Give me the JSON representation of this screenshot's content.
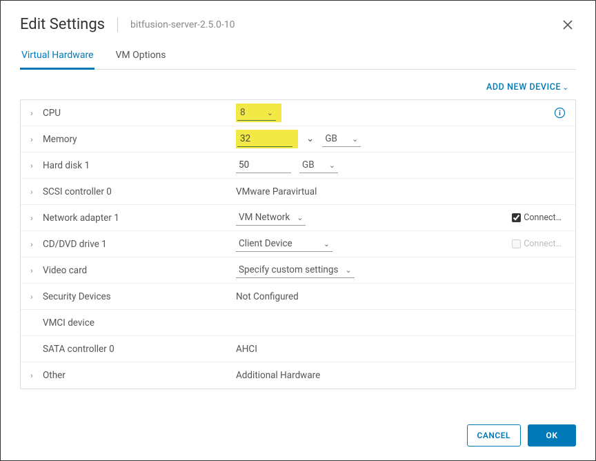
{
  "header": {
    "title": "Edit Settings",
    "subtitle": "bitfusion-server-2.5.0-10"
  },
  "tabs": {
    "hardware": "Virtual Hardware",
    "options": "VM Options"
  },
  "add_device": "ADD NEW DEVICE",
  "rows": {
    "cpu": {
      "label": "CPU",
      "value": "8"
    },
    "memory": {
      "label": "Memory",
      "value": "32",
      "unit": "GB"
    },
    "disk": {
      "label": "Hard disk 1",
      "value": "50",
      "unit": "GB"
    },
    "scsi": {
      "label": "SCSI controller 0",
      "value": "VMware Paravirtual"
    },
    "net": {
      "label": "Network adapter 1",
      "value": "VM Network",
      "connect": "Connect…"
    },
    "cdrom": {
      "label": "CD/DVD drive 1",
      "value": "Client Device",
      "connect": "Connect…"
    },
    "video": {
      "label": "Video card",
      "value": "Specify custom settings"
    },
    "sec": {
      "label": "Security Devices",
      "value": "Not Configured"
    },
    "vmci": {
      "label": "VMCI device"
    },
    "sata": {
      "label": "SATA controller 0",
      "value": "AHCI"
    },
    "other": {
      "label": "Other",
      "value": "Additional Hardware"
    }
  },
  "footer": {
    "cancel": "CANCEL",
    "ok": "OK"
  }
}
